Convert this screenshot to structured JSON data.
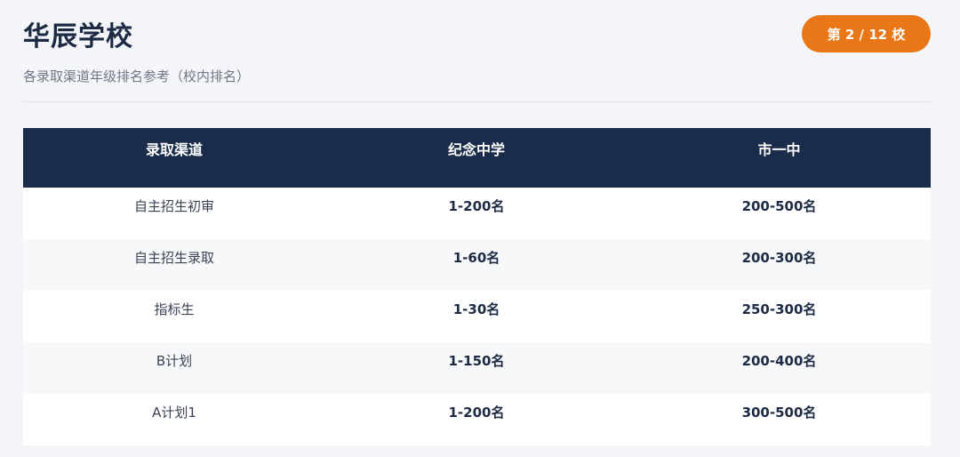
{
  "header": {
    "title": "华辰学校",
    "subtitle": "各录取渠道年级排名参考（校内排名）",
    "rank_badge": "第 2 / 12 校",
    "accent_color": "#ea7717"
  },
  "table": {
    "header_color": "#1b2c4a",
    "columns": [
      "录取渠道",
      "纪念中学",
      "市一中"
    ],
    "rows": [
      [
        "自主招生初审",
        "1-200名",
        "200-500名"
      ],
      [
        "自主招生录取",
        "1-60名",
        "200-300名"
      ],
      [
        "指标生",
        "1-30名",
        "250-300名"
      ],
      [
        "B计划",
        "1-150名",
        "200-400名"
      ],
      [
        "A计划1",
        "1-200名",
        "300-500名"
      ]
    ]
  }
}
